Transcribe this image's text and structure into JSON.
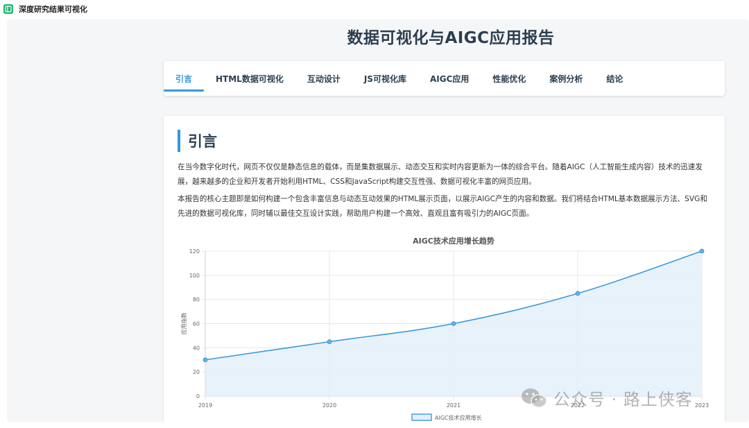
{
  "window": {
    "title": "深度研究结果可视化"
  },
  "page": {
    "title": "数据可视化与AIGC应用报告"
  },
  "nav": {
    "items": [
      {
        "label": "引言",
        "active": true
      },
      {
        "label": "HTML数据可视化",
        "active": false
      },
      {
        "label": "互动设计",
        "active": false
      },
      {
        "label": "JS可视化库",
        "active": false
      },
      {
        "label": "AIGC应用",
        "active": false
      },
      {
        "label": "性能优化",
        "active": false
      },
      {
        "label": "案例分析",
        "active": false
      },
      {
        "label": "结论",
        "active": false
      }
    ]
  },
  "section": {
    "heading": "引言",
    "paragraphs": [
      "在当今数字化时代，网页不仅仅是静态信息的载体，而是集数据展示、动态交互和实时内容更新为一体的综合平台。随着AIGC（人工智能生成内容）技术的迅速发展，越来越多的企业和开发者开始利用HTML、CSS和JavaScript构建交互性强、数据可视化丰富的网页应用。",
      "本报告的核心主题即是如何构建一个包含丰富信息与动态互动效果的HTML展示页面，以展示AIGC产生的内容和数据。我们将结合HTML基本数据展示方法、SVG和先进的数据可视化库，同时辅以最佳交互设计实践，帮助用户构建一个高效、直观且富有吸引力的AIGC页面。"
    ]
  },
  "chart_data": {
    "type": "area",
    "title": "AIGC技术应用增长趋势",
    "xlabel": "",
    "ylabel": "应用指数",
    "categories": [
      "2019",
      "2020",
      "2021",
      "2022",
      "2023"
    ],
    "series": [
      {
        "name": "AIGC技术应用增长",
        "values": [
          30,
          45,
          60,
          85,
          120
        ]
      }
    ],
    "ylim": [
      0,
      120
    ],
    "yticks": [
      0,
      20,
      40,
      60,
      80,
      100,
      120
    ],
    "grid": true,
    "legend": "bottom",
    "colors": {
      "line": "#3b9ad9",
      "fill": "#e3f0fa"
    }
  },
  "watermark": {
    "text": "公众号 · 路上侠客",
    "icon": "wechat-icon"
  },
  "colors": {
    "accent": "#3498db",
    "heading": "#2c3e50",
    "app_icon": "#22b573"
  }
}
